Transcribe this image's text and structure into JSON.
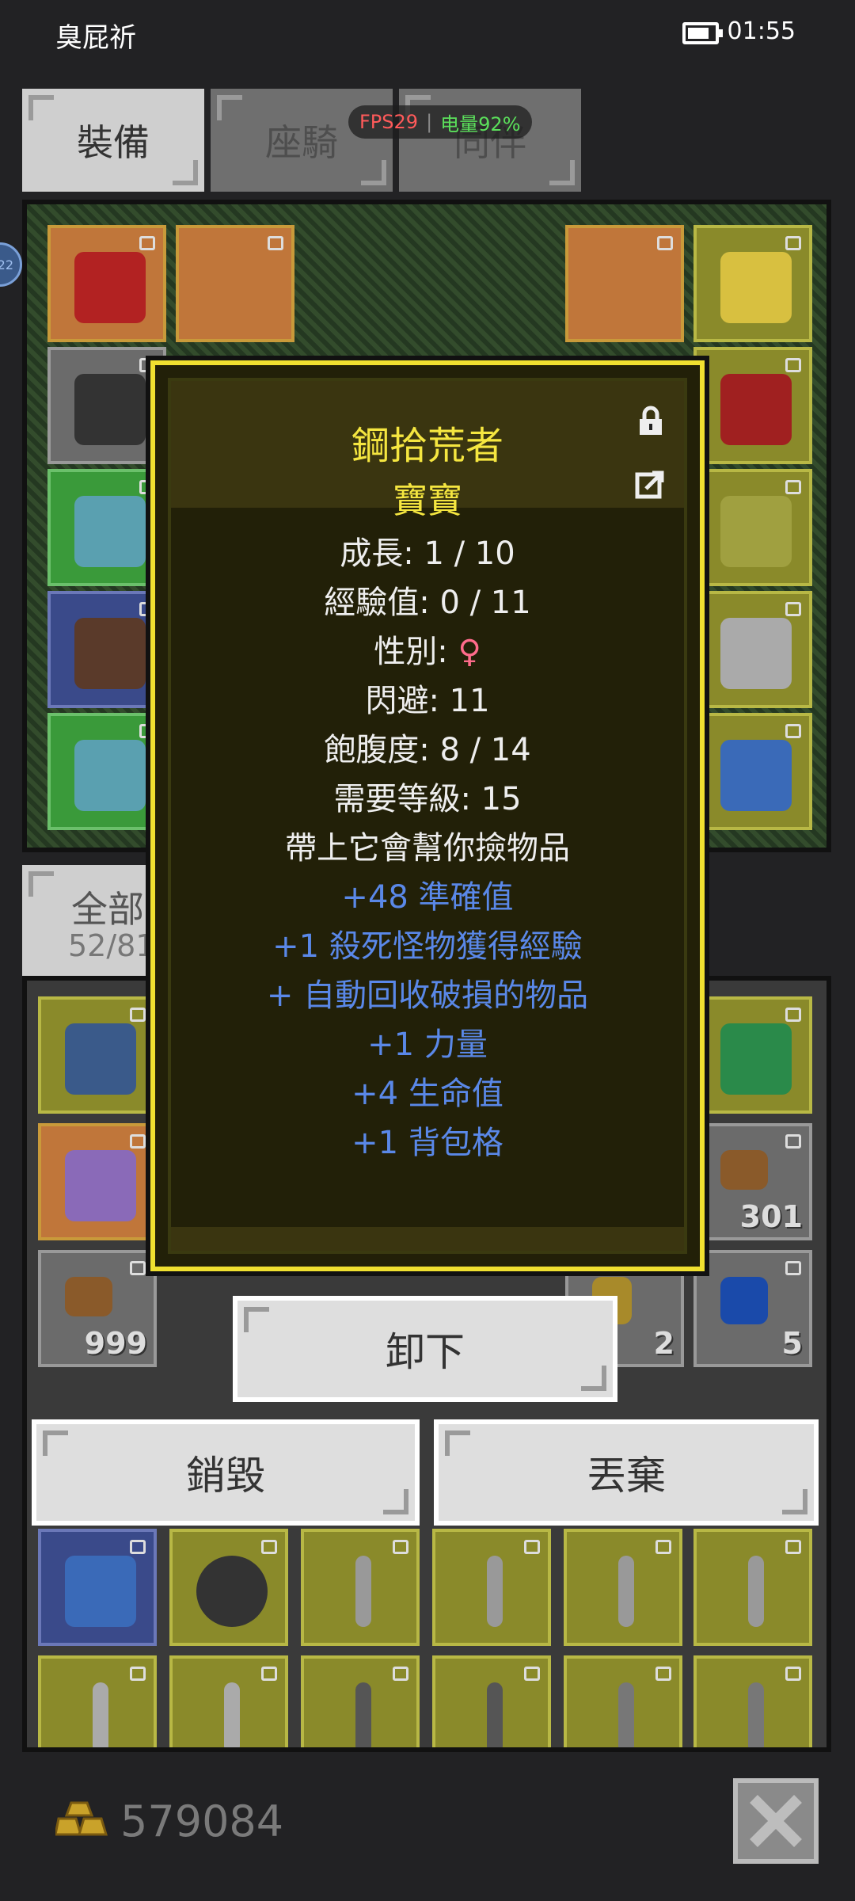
{
  "status_bar": {
    "left_text": "臭屁祈",
    "time": "01:55",
    "battery_level": 0.8
  },
  "tabs": [
    {
      "label": "裝備",
      "active": true
    },
    {
      "label": "座騎",
      "active": false
    },
    {
      "label": "同伴",
      "active": false
    }
  ],
  "overlay": {
    "fps": "FPS29",
    "battery": "电量92%"
  },
  "side_bubble": "22",
  "inventory_tab": {
    "label": "全部",
    "count": "52/81"
  },
  "inventory_quantities": [
    "301",
    "999",
    "2",
    "5"
  ],
  "tooltip": {
    "title": "鋼拾荒者",
    "subtitle": "寶寶",
    "stats": [
      "成長: 1 / 10",
      "經驗值: 0 / 11",
      "性別: ",
      "閃避: 11",
      "飽腹度: 8 / 14",
      "需要等級: 15",
      "帶上它會幫你撿物品"
    ],
    "gender_symbol": "♀",
    "bonuses": [
      "+48 準確值",
      "+1 殺死怪物獲得經驗",
      "+ 自動回收破損的物品",
      "+1 力量",
      "+4 生命值",
      "+1 背包格"
    ]
  },
  "buttons": {
    "unequip": "卸下",
    "destroy": "銷毀",
    "drop": "丟棄"
  },
  "gold": "579084",
  "colors": {
    "accent_yellow": "#f5e640",
    "bonus_blue": "#5a88e8",
    "female_pink": "#ff6b8b"
  }
}
